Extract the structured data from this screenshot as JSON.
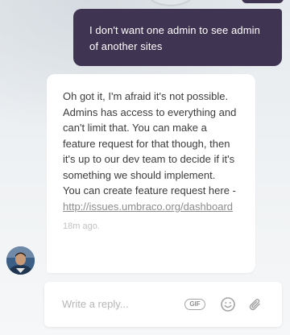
{
  "conversation": {
    "user_message": "I don't want one admin to see admin of another sites",
    "agent_message": {
      "text": "Oh got it, I'm afraid it's not possible. Admins has access to everything and can't limit that. You can make a feature request for that though, then it's up to our dev team to decide if it's something we should implement.\nYou can create feature request here - ",
      "link_text": "http://issues.umbraco.org/dashboard",
      "timestamp": "18m ago."
    }
  },
  "composer": {
    "placeholder": "Write a reply...",
    "gif_label": "GIF",
    "emoji_icon": "emoji-icon",
    "attach_icon": "paperclip-icon"
  },
  "colors": {
    "user_bubble": "#3f3452",
    "agent_bubble": "#ffffff",
    "link": "#8c8c8c",
    "timestamp": "#c2c2c2"
  }
}
